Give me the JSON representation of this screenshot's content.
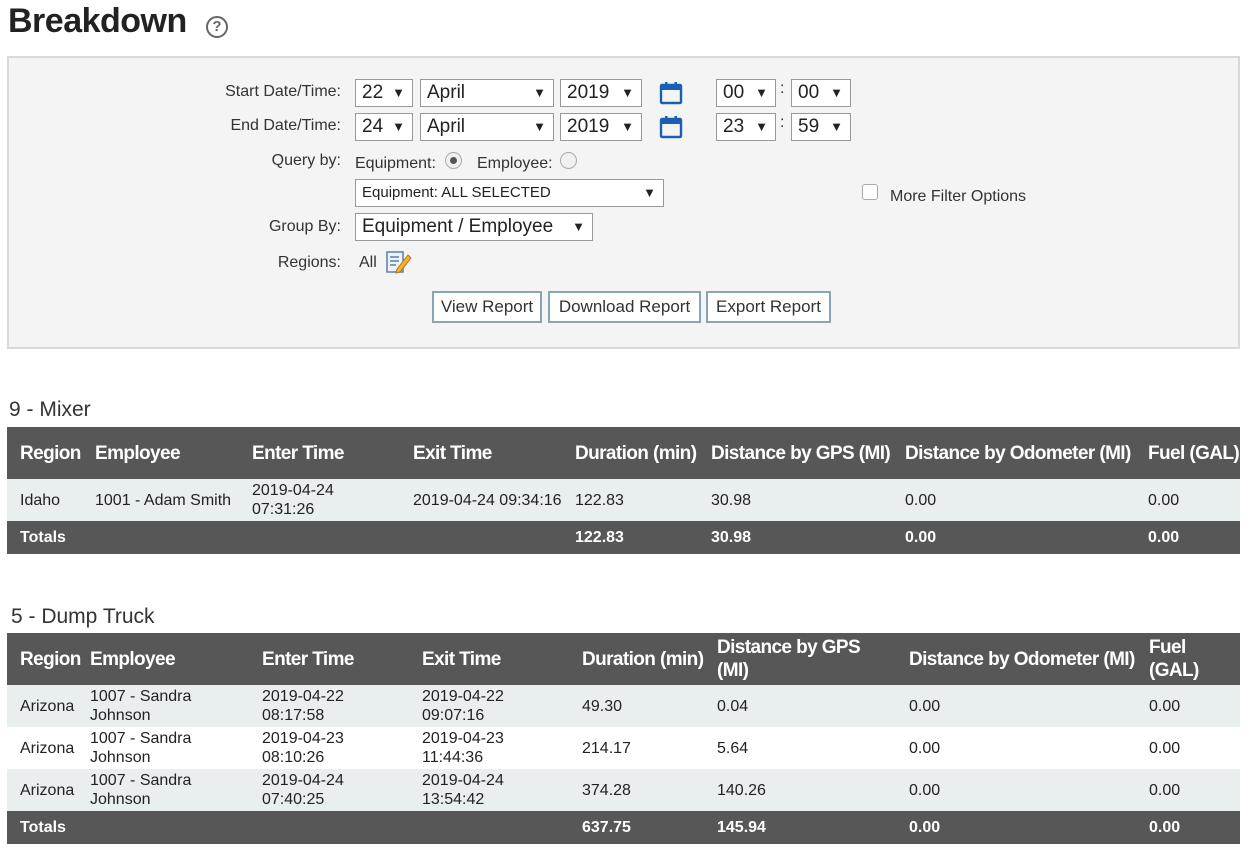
{
  "page": {
    "title": "Breakdown",
    "help_glyph": "?"
  },
  "filters": {
    "start_label": "Start Date/Time:",
    "end_label": "End Date/Time:",
    "start": {
      "day": "22",
      "month": "April",
      "year": "2019",
      "hour": "00",
      "minute": "00"
    },
    "end": {
      "day": "24",
      "month": "April",
      "year": "2019",
      "hour": "23",
      "minute": "59"
    },
    "time_separator": ":",
    "arrow": "▼",
    "query_label": "Query by:",
    "query_options": {
      "equipment": "Equipment:",
      "employee": "Employee:"
    },
    "query_selected": "equipment",
    "equipment_select": "Equipment: ALL SELECTED",
    "more_filter_label": "More Filter Options",
    "group_by_label": "Group By:",
    "group_by_value": "Equipment / Employee",
    "regions_label": "Regions:",
    "regions_value": "All",
    "buttons": {
      "view": "View Report",
      "download": "Download Report",
      "export": "Export Report"
    }
  },
  "colors": {
    "header_bg": "#575757",
    "row_alt": "#e9eeee",
    "calendar": "#1a5fb4",
    "button_border": "#8aa3b5"
  },
  "icons": {
    "help": "help-circle-icon",
    "calendar": "calendar-icon",
    "edit": "edit-regions-icon"
  },
  "reports": [
    {
      "title": "9 - Mixer",
      "columns": [
        "Region",
        "Employee",
        "Enter Time",
        "Exit Time",
        "Duration (min)",
        "Distance by GPS (MI)",
        "Distance by Odometer (MI)",
        "Fuel (GAL)"
      ],
      "rows": [
        [
          "Idaho",
          "1001 - Adam Smith",
          "2019-04-24 07:31:26",
          "2019-04-24 09:34:16",
          "122.83",
          "30.98",
          "0.00",
          "0.00"
        ]
      ],
      "totals": [
        "Totals",
        "122.83",
        "30.98",
        "0.00",
        "0.00"
      ]
    },
    {
      "title": "5 - Dump Truck",
      "columns": [
        "Region",
        "Employee",
        "Enter Time",
        "Exit Time",
        "Duration (min)",
        "Distance by GPS (MI)",
        "Distance by Odometer (MI)",
        "Fuel (GAL)"
      ],
      "rows": [
        [
          "Arizona",
          "1007 - Sandra Johnson",
          "2019-04-22 08:17:58",
          "2019-04-22 09:07:16",
          "49.30",
          "0.04",
          "0.00",
          "0.00"
        ],
        [
          "Arizona",
          "1007 - Sandra Johnson",
          "2019-04-23 08:10:26",
          "2019-04-23 11:44:36",
          "214.17",
          "5.64",
          "0.00",
          "0.00"
        ],
        [
          "Arizona",
          "1007 - Sandra Johnson",
          "2019-04-24 07:40:25",
          "2019-04-24 13:54:42",
          "374.28",
          "140.26",
          "0.00",
          "0.00"
        ]
      ],
      "totals": [
        "Totals",
        "637.75",
        "145.94",
        "0.00",
        "0.00"
      ]
    }
  ]
}
